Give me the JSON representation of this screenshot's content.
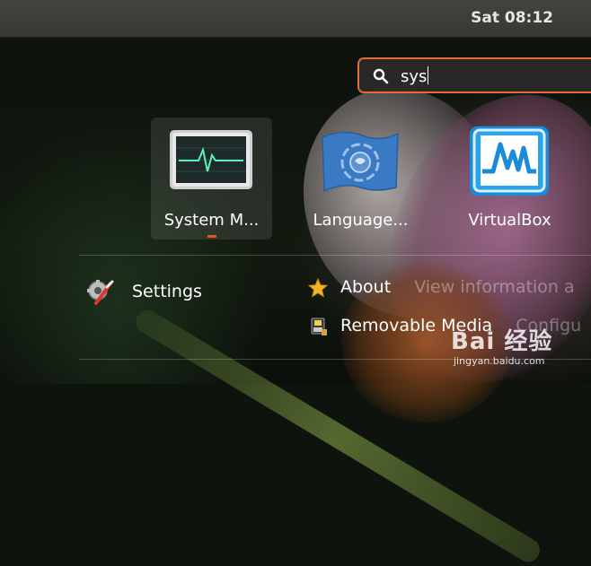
{
  "topbar": {
    "clock": "Sat 08:12"
  },
  "search": {
    "value": "sys",
    "icon": "search-icon"
  },
  "apps": [
    {
      "label": "System M...",
      "icon": "system-monitor-icon",
      "selected": true,
      "running": true
    },
    {
      "label": "Language...",
      "icon": "language-support-icon",
      "selected": false
    },
    {
      "label": "VirtualBox",
      "icon": "virtualbox-icon",
      "selected": false
    }
  ],
  "results": [
    {
      "label": "Settings",
      "icon": "settings-icon"
    },
    {
      "label": "About",
      "desc": "View information a",
      "icon": "star-icon"
    },
    {
      "label": "Removable Media",
      "desc": "Configu",
      "icon": "removable-media-icon"
    }
  ],
  "watermark": {
    "brand": "Bai  经验",
    "url": "jingyan.baidu.com"
  },
  "colors": {
    "accent": "#e66b35",
    "topbar": "#3e3c38",
    "running_dot": "#e95420"
  }
}
